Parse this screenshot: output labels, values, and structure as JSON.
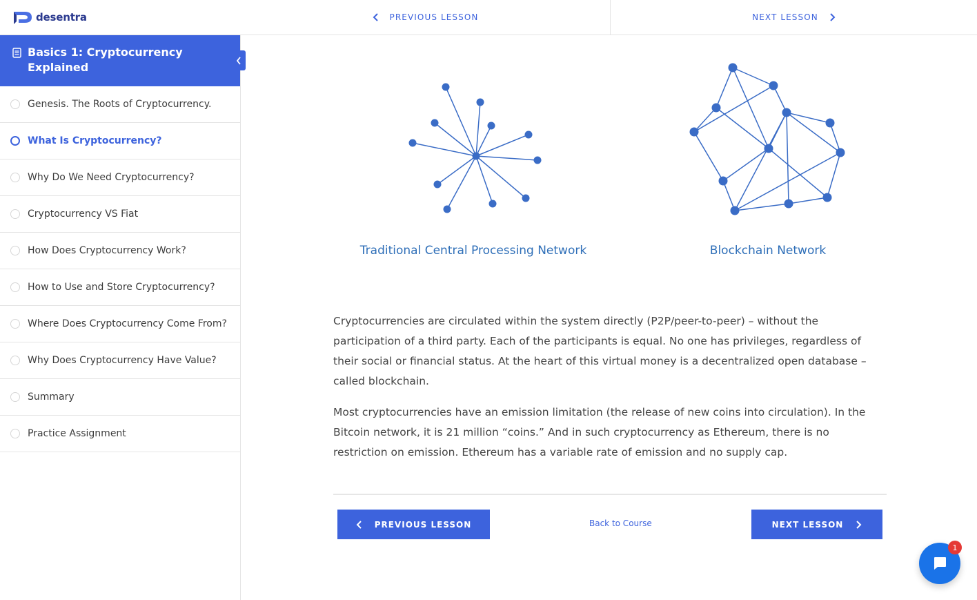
{
  "brand": {
    "name": "desentra",
    "color": "#2b3a8f"
  },
  "topbar": {
    "prev_label": "PREVIOUS LESSON",
    "next_label": "NEXT LESSON"
  },
  "sidebar": {
    "title": "Basics 1: Cryptocurrency Explained",
    "accent": "#3d63dd",
    "lessons": [
      {
        "label": "Genesis. The Roots of Cryptocurrency.",
        "active": false
      },
      {
        "label": "What Is Cryptocurrency?",
        "active": true
      },
      {
        "label": "Why Do We Need Cryptocurrency?",
        "active": false
      },
      {
        "label": "Cryptocurrency VS Fiat",
        "active": false
      },
      {
        "label": "How Does Cryptocurrency Work?",
        "active": false
      },
      {
        "label": "How to Use and Store Cryptocurrency?",
        "active": false
      },
      {
        "label": "Where Does Cryptocurrency Come From?",
        "active": false
      },
      {
        "label": "Why Does Cryptocurrency Have Value?",
        "active": false
      },
      {
        "label": "Summary",
        "active": false
      },
      {
        "label": "Practice Assignment",
        "active": false
      }
    ]
  },
  "diagrams": {
    "left_caption": "Traditional Central Processing Network",
    "right_caption": "Blockchain Network"
  },
  "content": {
    "paragraph_1": "Cryptocurrencies are circulated within the system directly (P2P/peer-to-peer) – without the participation of a third party. Each of the participants is equal. No one has privileges, regardless of their social or financial status. At the heart of this virtual money is a decentralized open database – called blockchain.",
    "paragraph_2": "Most cryptocurrencies have an emission limitation (the release of new coins into circulation). In the Bitcoin network, it is 21 million “coins.” And in such cryptocurrency as Ethereum, there is no restriction on emission. Ethereum has a variable rate of emission and no supply cap."
  },
  "footer_nav": {
    "prev_label": "PREVIOUS LESSON",
    "back_label": "Back to Course",
    "next_label": "NEXT LESSON"
  },
  "chat": {
    "badge_count": "1"
  }
}
